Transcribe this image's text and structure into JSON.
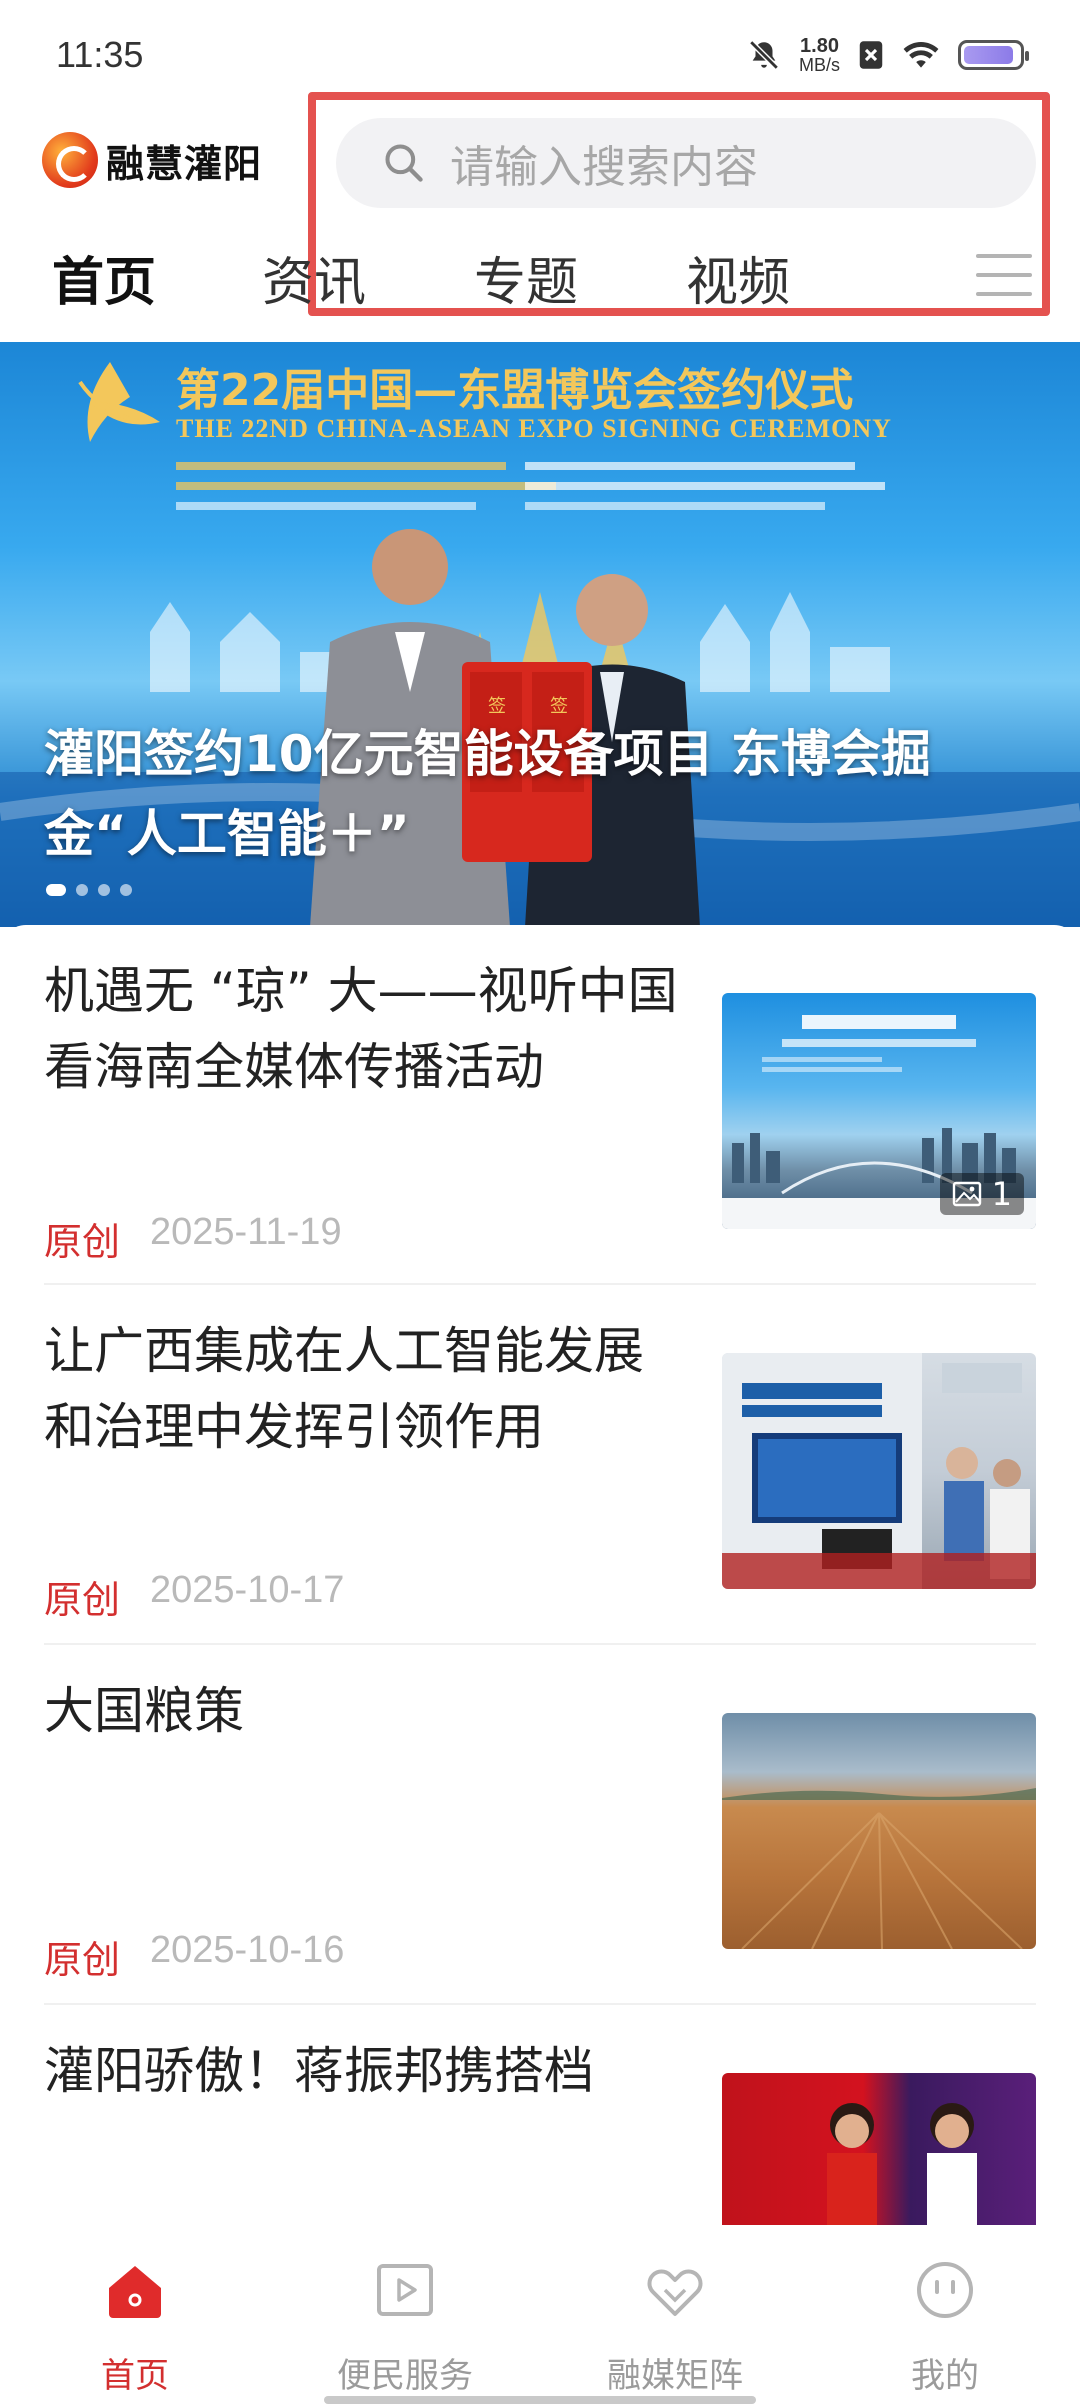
{
  "status_bar": {
    "time": "11:35",
    "net_speed_value": "1.80",
    "net_speed_unit": "MB/s",
    "battery_level": 0.9,
    "icons": [
      "mute-icon",
      "net-speed-indicator",
      "no-sim-icon",
      "wifi-icon",
      "battery-icon"
    ]
  },
  "header": {
    "logo_text": "融慧灌阳",
    "search_placeholder": "请输入搜索内容"
  },
  "tabs": [
    {
      "label": "首页",
      "active": true
    },
    {
      "label": "资讯",
      "active": false
    },
    {
      "label": "专题",
      "active": false
    },
    {
      "label": "视频",
      "active": false
    }
  ],
  "banner": {
    "title_cn": "第22届中国—东盟博览会签约仪式",
    "title_en": "THE 22ND CHINA-ASEAN EXPO SIGNING CEREMONY",
    "caption": "灌阳签约10亿元智能设备项目 东博会掘金“人工智能＋”",
    "slide_count": 4,
    "active_slide": 1
  },
  "news": [
    {
      "title": "机遇无 “琼” 大——视听中国看海南全媒体传播活动",
      "tag": "原创",
      "date": "2025-11-19",
      "image_count": "1"
    },
    {
      "title": "让广西集成在人工智能发展和治理中发挥引领作用",
      "tag": "原创",
      "date": "2025-10-17"
    },
    {
      "title": "大国粮策",
      "tag": "原创",
      "date": "2025-10-16"
    },
    {
      "title": "灌阳骄傲！蒋振邦携搭档"
    }
  ],
  "bottom_nav": [
    {
      "label": "首页",
      "icon": "home-icon",
      "active": true
    },
    {
      "label": "便民服务",
      "icon": "service-play-icon",
      "active": false
    },
    {
      "label": "融媒矩阵",
      "icon": "matrix-heart-icon",
      "active": false
    },
    {
      "label": "我的",
      "icon": "smile-face-icon",
      "active": false
    }
  ],
  "colors": {
    "accent": "#d32f2f",
    "search_highlight": "#e4524f",
    "banner_gold": "#f3c75b"
  }
}
